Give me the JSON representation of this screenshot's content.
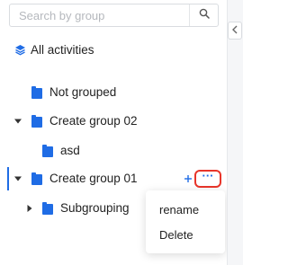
{
  "search": {
    "placeholder": "Search by group"
  },
  "all_activities": {
    "label": "All activities",
    "icon": "layers-icon"
  },
  "tree": [
    {
      "label": "Not grouped",
      "level": 1,
      "expanded": null,
      "selected": false
    },
    {
      "label": "Create group 02",
      "level": 1,
      "expanded": true,
      "selected": false
    },
    {
      "label": "asd",
      "level": 2,
      "expanded": null,
      "selected": false
    },
    {
      "label": "Create group 01",
      "level": 1,
      "expanded": true,
      "selected": true
    },
    {
      "label": "Subgrouping",
      "level": 2,
      "expanded": false,
      "selected": false
    }
  ],
  "row_actions": {
    "more_label": "···"
  },
  "context_menu": {
    "items": [
      "rename",
      "Delete"
    ]
  },
  "colors": {
    "accent": "#1f6ce5",
    "highlight": "#e8352a",
    "text": "#222222",
    "placeholder": "#b5b8bd"
  }
}
